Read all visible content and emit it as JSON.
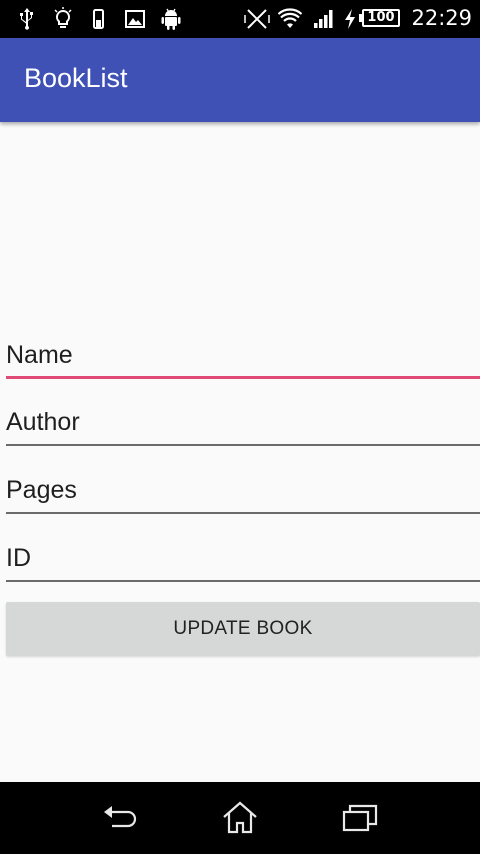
{
  "status_bar": {
    "time": "22:29",
    "battery": "100",
    "icons": [
      "usb-icon",
      "lightbulb-icon",
      "device-icon",
      "image-icon",
      "android-icon",
      "vibrate-off-icon",
      "wifi-icon",
      "signal-icon",
      "charging-icon",
      "battery-icon"
    ]
  },
  "app_bar": {
    "title": "BookList",
    "color": "#3f51b5"
  },
  "form": {
    "name": {
      "placeholder": "Name",
      "value": ""
    },
    "author": {
      "placeholder": "Author",
      "value": ""
    },
    "pages": {
      "placeholder": "Pages",
      "value": ""
    },
    "id": {
      "placeholder": "ID",
      "value": ""
    },
    "focus_color": "#e04a77",
    "update_button_label": "UPDATE BOOK"
  },
  "nav_bar": {
    "buttons": [
      "back-icon",
      "home-icon",
      "recents-icon"
    ]
  }
}
